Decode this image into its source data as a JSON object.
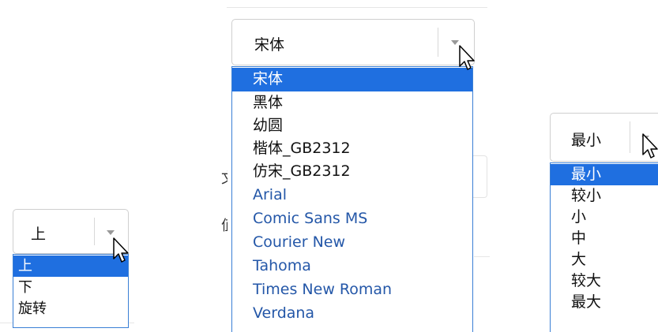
{
  "position_select": {
    "value": "上",
    "options": [
      "上",
      "下",
      "旋转"
    ],
    "selected_index": 0
  },
  "font_select": {
    "value": "宋体",
    "options": [
      "宋体",
      "黑体",
      "幼圆",
      "楷体_GB2312",
      "仿宋_GB2312",
      "Arial",
      "Comic Sans MS",
      "Courier New",
      "Tahoma",
      "Times New Roman",
      "Verdana"
    ],
    "selected_index": 0
  },
  "size_select": {
    "value": "最小",
    "options": [
      "最小",
      "较小",
      "小",
      "中",
      "大",
      "较大",
      "最大"
    ],
    "selected_index": 0
  },
  "background_fragments": {
    "middle_left_a": "文",
    "middle_left_b": "值"
  },
  "colors": {
    "accent": "#1f6fe0",
    "list_border": "#3a7fd5",
    "english_font_text": "#2457a8"
  }
}
